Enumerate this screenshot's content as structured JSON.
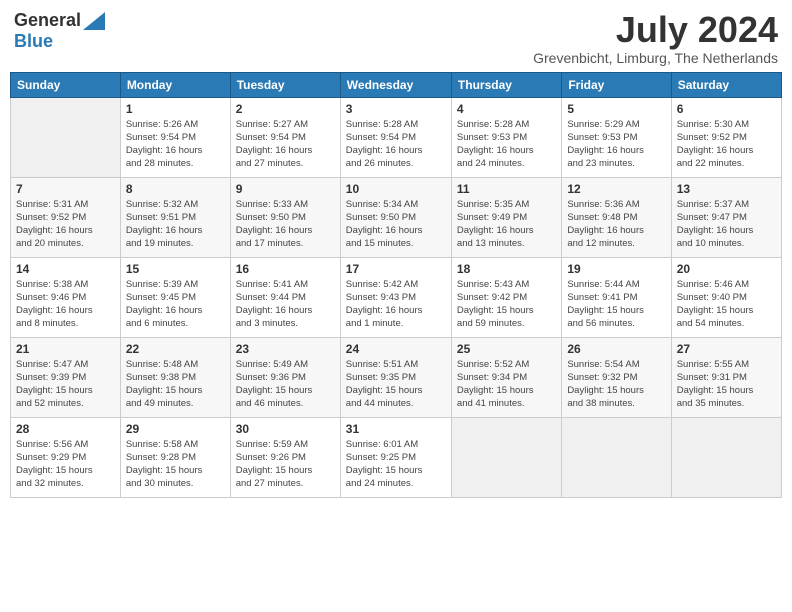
{
  "logo": {
    "general": "General",
    "blue": "Blue"
  },
  "title": "July 2024",
  "location": "Grevenbicht, Limburg, The Netherlands",
  "days_of_week": [
    "Sunday",
    "Monday",
    "Tuesday",
    "Wednesday",
    "Thursday",
    "Friday",
    "Saturday"
  ],
  "weeks": [
    [
      {
        "day": "",
        "info": ""
      },
      {
        "day": "1",
        "info": "Sunrise: 5:26 AM\nSunset: 9:54 PM\nDaylight: 16 hours\nand 28 minutes."
      },
      {
        "day": "2",
        "info": "Sunrise: 5:27 AM\nSunset: 9:54 PM\nDaylight: 16 hours\nand 27 minutes."
      },
      {
        "day": "3",
        "info": "Sunrise: 5:28 AM\nSunset: 9:54 PM\nDaylight: 16 hours\nand 26 minutes."
      },
      {
        "day": "4",
        "info": "Sunrise: 5:28 AM\nSunset: 9:53 PM\nDaylight: 16 hours\nand 24 minutes."
      },
      {
        "day": "5",
        "info": "Sunrise: 5:29 AM\nSunset: 9:53 PM\nDaylight: 16 hours\nand 23 minutes."
      },
      {
        "day": "6",
        "info": "Sunrise: 5:30 AM\nSunset: 9:52 PM\nDaylight: 16 hours\nand 22 minutes."
      }
    ],
    [
      {
        "day": "7",
        "info": "Sunrise: 5:31 AM\nSunset: 9:52 PM\nDaylight: 16 hours\nand 20 minutes."
      },
      {
        "day": "8",
        "info": "Sunrise: 5:32 AM\nSunset: 9:51 PM\nDaylight: 16 hours\nand 19 minutes."
      },
      {
        "day": "9",
        "info": "Sunrise: 5:33 AM\nSunset: 9:50 PM\nDaylight: 16 hours\nand 17 minutes."
      },
      {
        "day": "10",
        "info": "Sunrise: 5:34 AM\nSunset: 9:50 PM\nDaylight: 16 hours\nand 15 minutes."
      },
      {
        "day": "11",
        "info": "Sunrise: 5:35 AM\nSunset: 9:49 PM\nDaylight: 16 hours\nand 13 minutes."
      },
      {
        "day": "12",
        "info": "Sunrise: 5:36 AM\nSunset: 9:48 PM\nDaylight: 16 hours\nand 12 minutes."
      },
      {
        "day": "13",
        "info": "Sunrise: 5:37 AM\nSunset: 9:47 PM\nDaylight: 16 hours\nand 10 minutes."
      }
    ],
    [
      {
        "day": "14",
        "info": "Sunrise: 5:38 AM\nSunset: 9:46 PM\nDaylight: 16 hours\nand 8 minutes."
      },
      {
        "day": "15",
        "info": "Sunrise: 5:39 AM\nSunset: 9:45 PM\nDaylight: 16 hours\nand 6 minutes."
      },
      {
        "day": "16",
        "info": "Sunrise: 5:41 AM\nSunset: 9:44 PM\nDaylight: 16 hours\nand 3 minutes."
      },
      {
        "day": "17",
        "info": "Sunrise: 5:42 AM\nSunset: 9:43 PM\nDaylight: 16 hours\nand 1 minute."
      },
      {
        "day": "18",
        "info": "Sunrise: 5:43 AM\nSunset: 9:42 PM\nDaylight: 15 hours\nand 59 minutes."
      },
      {
        "day": "19",
        "info": "Sunrise: 5:44 AM\nSunset: 9:41 PM\nDaylight: 15 hours\nand 56 minutes."
      },
      {
        "day": "20",
        "info": "Sunrise: 5:46 AM\nSunset: 9:40 PM\nDaylight: 15 hours\nand 54 minutes."
      }
    ],
    [
      {
        "day": "21",
        "info": "Sunrise: 5:47 AM\nSunset: 9:39 PM\nDaylight: 15 hours\nand 52 minutes."
      },
      {
        "day": "22",
        "info": "Sunrise: 5:48 AM\nSunset: 9:38 PM\nDaylight: 15 hours\nand 49 minutes."
      },
      {
        "day": "23",
        "info": "Sunrise: 5:49 AM\nSunset: 9:36 PM\nDaylight: 15 hours\nand 46 minutes."
      },
      {
        "day": "24",
        "info": "Sunrise: 5:51 AM\nSunset: 9:35 PM\nDaylight: 15 hours\nand 44 minutes."
      },
      {
        "day": "25",
        "info": "Sunrise: 5:52 AM\nSunset: 9:34 PM\nDaylight: 15 hours\nand 41 minutes."
      },
      {
        "day": "26",
        "info": "Sunrise: 5:54 AM\nSunset: 9:32 PM\nDaylight: 15 hours\nand 38 minutes."
      },
      {
        "day": "27",
        "info": "Sunrise: 5:55 AM\nSunset: 9:31 PM\nDaylight: 15 hours\nand 35 minutes."
      }
    ],
    [
      {
        "day": "28",
        "info": "Sunrise: 5:56 AM\nSunset: 9:29 PM\nDaylight: 15 hours\nand 32 minutes."
      },
      {
        "day": "29",
        "info": "Sunrise: 5:58 AM\nSunset: 9:28 PM\nDaylight: 15 hours\nand 30 minutes."
      },
      {
        "day": "30",
        "info": "Sunrise: 5:59 AM\nSunset: 9:26 PM\nDaylight: 15 hours\nand 27 minutes."
      },
      {
        "day": "31",
        "info": "Sunrise: 6:01 AM\nSunset: 9:25 PM\nDaylight: 15 hours\nand 24 minutes."
      },
      {
        "day": "",
        "info": ""
      },
      {
        "day": "",
        "info": ""
      },
      {
        "day": "",
        "info": ""
      }
    ]
  ]
}
